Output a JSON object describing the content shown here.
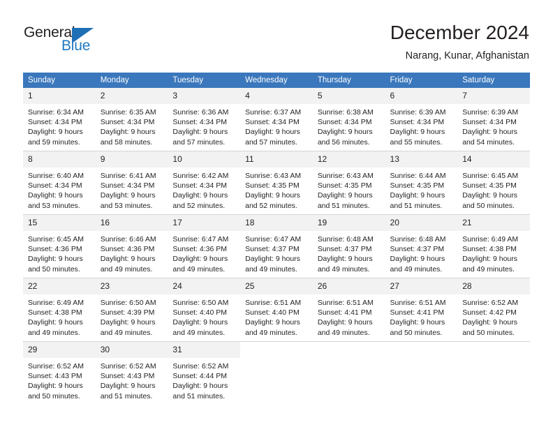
{
  "brand": {
    "word_one": "General",
    "word_two": "Blue",
    "accent_color": "#2079c2",
    "triangle_color": "#1e6fb5",
    "triangle_icon": "triangle-icon"
  },
  "header": {
    "title": "December 2024",
    "subtitle": "Narang, Kunar, Afghanistan"
  },
  "theme": {
    "header_row_bg": "#3a77bc",
    "header_row_text": "#ffffff",
    "daynum_bg": "#f2f2f2",
    "cell_bg": "#ffffff",
    "grid_line": "#d4d4d4",
    "text": "#231f20"
  },
  "calendar": {
    "weekday_headers": [
      "Sunday",
      "Monday",
      "Tuesday",
      "Wednesday",
      "Thursday",
      "Friday",
      "Saturday"
    ],
    "weeks": [
      [
        {
          "day": "1",
          "sunrise": "Sunrise: 6:34 AM",
          "sunset": "Sunset: 4:34 PM",
          "daylight_line1": "Daylight: 9 hours",
          "daylight_line2": "and 59 minutes."
        },
        {
          "day": "2",
          "sunrise": "Sunrise: 6:35 AM",
          "sunset": "Sunset: 4:34 PM",
          "daylight_line1": "Daylight: 9 hours",
          "daylight_line2": "and 58 minutes."
        },
        {
          "day": "3",
          "sunrise": "Sunrise: 6:36 AM",
          "sunset": "Sunset: 4:34 PM",
          "daylight_line1": "Daylight: 9 hours",
          "daylight_line2": "and 57 minutes."
        },
        {
          "day": "4",
          "sunrise": "Sunrise: 6:37 AM",
          "sunset": "Sunset: 4:34 PM",
          "daylight_line1": "Daylight: 9 hours",
          "daylight_line2": "and 57 minutes."
        },
        {
          "day": "5",
          "sunrise": "Sunrise: 6:38 AM",
          "sunset": "Sunset: 4:34 PM",
          "daylight_line1": "Daylight: 9 hours",
          "daylight_line2": "and 56 minutes."
        },
        {
          "day": "6",
          "sunrise": "Sunrise: 6:39 AM",
          "sunset": "Sunset: 4:34 PM",
          "daylight_line1": "Daylight: 9 hours",
          "daylight_line2": "and 55 minutes."
        },
        {
          "day": "7",
          "sunrise": "Sunrise: 6:39 AM",
          "sunset": "Sunset: 4:34 PM",
          "daylight_line1": "Daylight: 9 hours",
          "daylight_line2": "and 54 minutes."
        }
      ],
      [
        {
          "day": "8",
          "sunrise": "Sunrise: 6:40 AM",
          "sunset": "Sunset: 4:34 PM",
          "daylight_line1": "Daylight: 9 hours",
          "daylight_line2": "and 53 minutes."
        },
        {
          "day": "9",
          "sunrise": "Sunrise: 6:41 AM",
          "sunset": "Sunset: 4:34 PM",
          "daylight_line1": "Daylight: 9 hours",
          "daylight_line2": "and 53 minutes."
        },
        {
          "day": "10",
          "sunrise": "Sunrise: 6:42 AM",
          "sunset": "Sunset: 4:34 PM",
          "daylight_line1": "Daylight: 9 hours",
          "daylight_line2": "and 52 minutes."
        },
        {
          "day": "11",
          "sunrise": "Sunrise: 6:43 AM",
          "sunset": "Sunset: 4:35 PM",
          "daylight_line1": "Daylight: 9 hours",
          "daylight_line2": "and 52 minutes."
        },
        {
          "day": "12",
          "sunrise": "Sunrise: 6:43 AM",
          "sunset": "Sunset: 4:35 PM",
          "daylight_line1": "Daylight: 9 hours",
          "daylight_line2": "and 51 minutes."
        },
        {
          "day": "13",
          "sunrise": "Sunrise: 6:44 AM",
          "sunset": "Sunset: 4:35 PM",
          "daylight_line1": "Daylight: 9 hours",
          "daylight_line2": "and 51 minutes."
        },
        {
          "day": "14",
          "sunrise": "Sunrise: 6:45 AM",
          "sunset": "Sunset: 4:35 PM",
          "daylight_line1": "Daylight: 9 hours",
          "daylight_line2": "and 50 minutes."
        }
      ],
      [
        {
          "day": "15",
          "sunrise": "Sunrise: 6:45 AM",
          "sunset": "Sunset: 4:36 PM",
          "daylight_line1": "Daylight: 9 hours",
          "daylight_line2": "and 50 minutes."
        },
        {
          "day": "16",
          "sunrise": "Sunrise: 6:46 AM",
          "sunset": "Sunset: 4:36 PM",
          "daylight_line1": "Daylight: 9 hours",
          "daylight_line2": "and 49 minutes."
        },
        {
          "day": "17",
          "sunrise": "Sunrise: 6:47 AM",
          "sunset": "Sunset: 4:36 PM",
          "daylight_line1": "Daylight: 9 hours",
          "daylight_line2": "and 49 minutes."
        },
        {
          "day": "18",
          "sunrise": "Sunrise: 6:47 AM",
          "sunset": "Sunset: 4:37 PM",
          "daylight_line1": "Daylight: 9 hours",
          "daylight_line2": "and 49 minutes."
        },
        {
          "day": "19",
          "sunrise": "Sunrise: 6:48 AM",
          "sunset": "Sunset: 4:37 PM",
          "daylight_line1": "Daylight: 9 hours",
          "daylight_line2": "and 49 minutes."
        },
        {
          "day": "20",
          "sunrise": "Sunrise: 6:48 AM",
          "sunset": "Sunset: 4:37 PM",
          "daylight_line1": "Daylight: 9 hours",
          "daylight_line2": "and 49 minutes."
        },
        {
          "day": "21",
          "sunrise": "Sunrise: 6:49 AM",
          "sunset": "Sunset: 4:38 PM",
          "daylight_line1": "Daylight: 9 hours",
          "daylight_line2": "and 49 minutes."
        }
      ],
      [
        {
          "day": "22",
          "sunrise": "Sunrise: 6:49 AM",
          "sunset": "Sunset: 4:38 PM",
          "daylight_line1": "Daylight: 9 hours",
          "daylight_line2": "and 49 minutes."
        },
        {
          "day": "23",
          "sunrise": "Sunrise: 6:50 AM",
          "sunset": "Sunset: 4:39 PM",
          "daylight_line1": "Daylight: 9 hours",
          "daylight_line2": "and 49 minutes."
        },
        {
          "day": "24",
          "sunrise": "Sunrise: 6:50 AM",
          "sunset": "Sunset: 4:40 PM",
          "daylight_line1": "Daylight: 9 hours",
          "daylight_line2": "and 49 minutes."
        },
        {
          "day": "25",
          "sunrise": "Sunrise: 6:51 AM",
          "sunset": "Sunset: 4:40 PM",
          "daylight_line1": "Daylight: 9 hours",
          "daylight_line2": "and 49 minutes."
        },
        {
          "day": "26",
          "sunrise": "Sunrise: 6:51 AM",
          "sunset": "Sunset: 4:41 PM",
          "daylight_line1": "Daylight: 9 hours",
          "daylight_line2": "and 49 minutes."
        },
        {
          "day": "27",
          "sunrise": "Sunrise: 6:51 AM",
          "sunset": "Sunset: 4:41 PM",
          "daylight_line1": "Daylight: 9 hours",
          "daylight_line2": "and 50 minutes."
        },
        {
          "day": "28",
          "sunrise": "Sunrise: 6:52 AM",
          "sunset": "Sunset: 4:42 PM",
          "daylight_line1": "Daylight: 9 hours",
          "daylight_line2": "and 50 minutes."
        }
      ],
      [
        {
          "day": "29",
          "sunrise": "Sunrise: 6:52 AM",
          "sunset": "Sunset: 4:43 PM",
          "daylight_line1": "Daylight: 9 hours",
          "daylight_line2": "and 50 minutes."
        },
        {
          "day": "30",
          "sunrise": "Sunrise: 6:52 AM",
          "sunset": "Sunset: 4:43 PM",
          "daylight_line1": "Daylight: 9 hours",
          "daylight_line2": "and 51 minutes."
        },
        {
          "day": "31",
          "sunrise": "Sunrise: 6:52 AM",
          "sunset": "Sunset: 4:44 PM",
          "daylight_line1": "Daylight: 9 hours",
          "daylight_line2": "and 51 minutes."
        },
        {
          "day": "",
          "sunrise": "",
          "sunset": "",
          "daylight_line1": "",
          "daylight_line2": ""
        },
        {
          "day": "",
          "sunrise": "",
          "sunset": "",
          "daylight_line1": "",
          "daylight_line2": ""
        },
        {
          "day": "",
          "sunrise": "",
          "sunset": "",
          "daylight_line1": "",
          "daylight_line2": ""
        },
        {
          "day": "",
          "sunrise": "",
          "sunset": "",
          "daylight_line1": "",
          "daylight_line2": ""
        }
      ]
    ]
  }
}
